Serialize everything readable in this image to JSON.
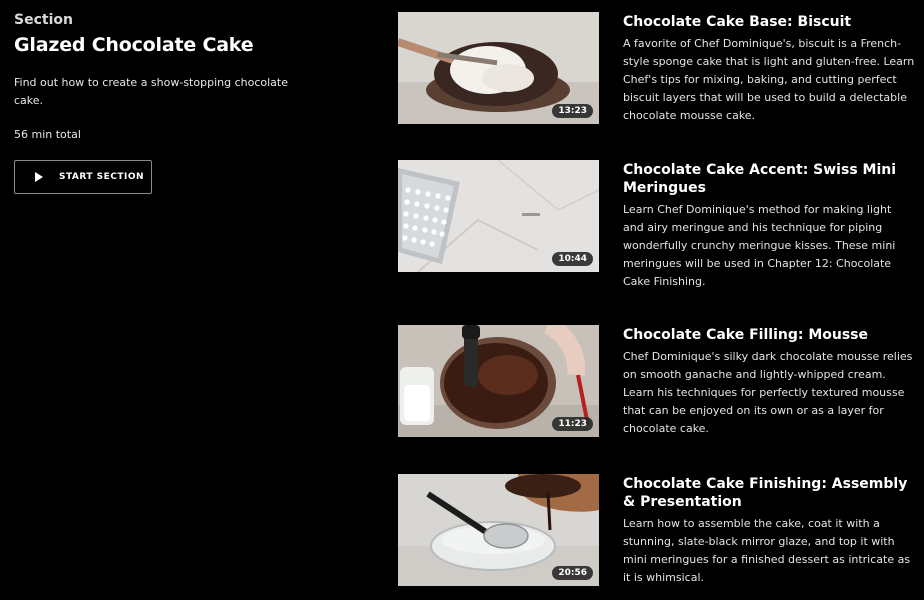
{
  "section": {
    "label": "Section",
    "title": "Glazed Chocolate Cake",
    "description": "Find out how to create a show-stopping chocolate cake.",
    "total": "56 min total",
    "start_button": "START SECTION"
  },
  "lessons": [
    {
      "title": "Chocolate Cake Base: Biscuit",
      "description": "A favorite of Chef Dominique's, biscuit is a French-style sponge cake that is light and gluten-free. Learn Chef's tips for mixing, baking, and cutting perfect biscuit layers that will be used to build a delectable chocolate mousse cake.",
      "duration": "13:23"
    },
    {
      "title": "Chocolate Cake Accent: Swiss Mini Meringues",
      "description": "Learn Chef Dominique's method for making light and airy meringue and his technique for piping wonderfully crunchy meringue kisses. These mini meringues will be used in Chapter 12: Chocolate Cake Finishing.",
      "duration": "10:44"
    },
    {
      "title": "Chocolate Cake Filling: Mousse",
      "description": "Chef Dominique's silky dark chocolate mousse relies on smooth ganache and lightly-whipped cream. Learn his techniques for perfectly textured mousse that can be enjoyed on its own or as a layer for chocolate cake.",
      "duration": "11:23"
    },
    {
      "title": "Chocolate Cake Finishing: Assembly & Presentation",
      "description": "Learn how to assemble the cake, coat it with a stunning, slate-black mirror glaze, and top it with mini meringues for a finished dessert as intricate as it is whimsical.",
      "duration": "20:56"
    }
  ]
}
